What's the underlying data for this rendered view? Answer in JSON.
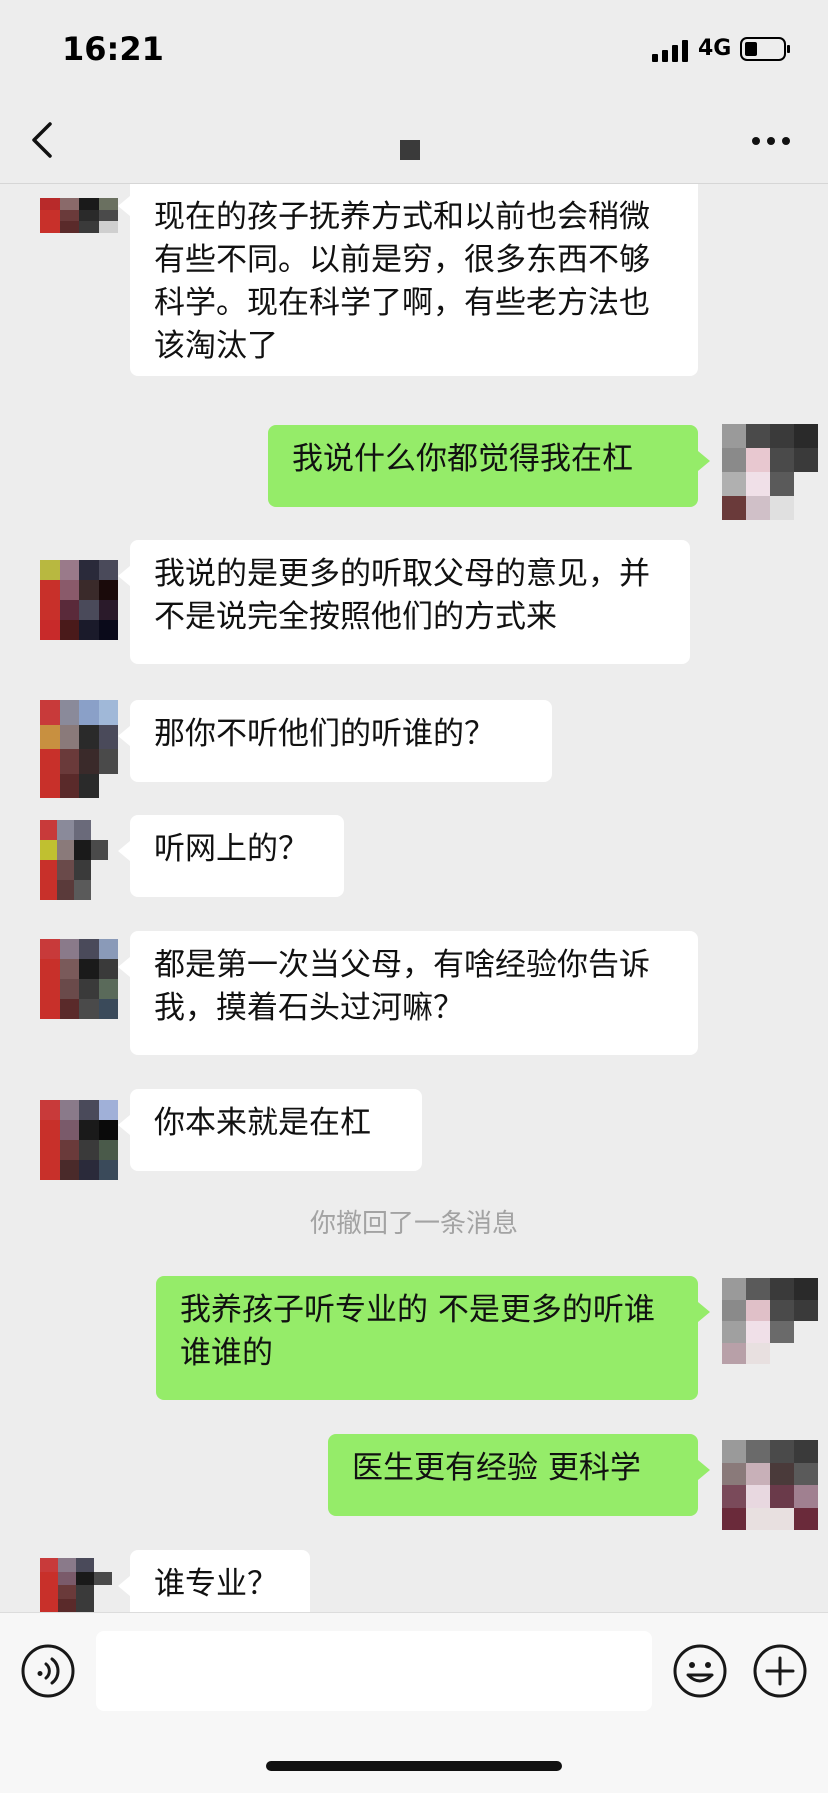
{
  "status_bar": {
    "time": "16:21",
    "network": "4G"
  },
  "nav": {
    "title": ""
  },
  "messages": [
    {
      "side": "in",
      "text": "现在的孩子抚养方式和以前也会稍微有些不同。以前是穷，很多东西不够科学。现在科学了啊，有些老方法也该淘汰了"
    },
    {
      "side": "out",
      "text": "我说什么你都觉得我在杠"
    },
    {
      "side": "in",
      "text": "我说的是更多的听取父母的意见，并不是说完全按照他们的方式来"
    },
    {
      "side": "in",
      "text": "那你不听他们的听谁的？"
    },
    {
      "side": "in",
      "text": "听网上的？"
    },
    {
      "side": "in",
      "text": "都是第一次当父母，有啥经验你告诉我，摸着石头过河嘛？"
    },
    {
      "side": "in",
      "text": "你本来就是在杠"
    },
    {
      "side": "out",
      "text": "我养孩子听专业的 不是更多的听谁谁谁的"
    },
    {
      "side": "out",
      "text": "医生更有经验 更科学"
    },
    {
      "side": "in",
      "text": "谁专业？"
    }
  ],
  "system_note": "你撤回了一条消息",
  "input": {
    "placeholder": "",
    "value": ""
  },
  "icons": {
    "back": "chevron-left-icon",
    "more": "more-dots-icon",
    "voice": "voice-icon",
    "emoji": "emoji-icon",
    "plus": "plus-icon"
  },
  "colors": {
    "background": "#ededed",
    "incoming_bubble": "#ffffff",
    "outgoing_bubble": "#95ec69",
    "system_text": "#a3a3a3"
  }
}
